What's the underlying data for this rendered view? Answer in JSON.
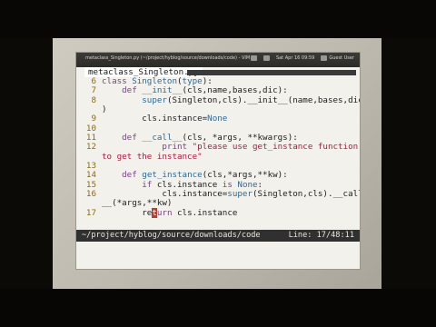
{
  "window": {
    "title": "metaclass_Singleton.py (~/project/hyblog/source/downloads/code) - VIM",
    "tray": {
      "volume": "",
      "network": "",
      "clock": "Sat Apr 16 09:59",
      "user": "Guest User"
    }
  },
  "tab": {
    "label": "metaclass_Singleton.py"
  },
  "editor": {
    "lines": [
      {
        "num": "6",
        "segments": [
          {
            "t": "class ",
            "c": "kw"
          },
          {
            "t": "Singleton",
            "c": "fn"
          },
          {
            "t": "("
          },
          {
            "t": "type",
            "c": "fn"
          },
          {
            "t": "):"
          }
        ]
      },
      {
        "num": "7",
        "segments": [
          {
            "t": "    "
          },
          {
            "t": "def ",
            "c": "kw"
          },
          {
            "t": "__init__",
            "c": "fn"
          },
          {
            "t": "(cls,name,bases,dic):"
          }
        ]
      },
      {
        "num": "8",
        "segments": [
          {
            "t": "        "
          },
          {
            "t": "super",
            "c": "fn"
          },
          {
            "t": "(Singleton,cls).__init__(name,bases,dic"
          }
        ]
      },
      {
        "num": "",
        "segments": [
          {
            "t": ")"
          }
        ]
      },
      {
        "num": "9",
        "segments": [
          {
            "t": "        cls.instance="
          },
          {
            "t": "None",
            "c": "sp"
          }
        ]
      },
      {
        "num": "10",
        "segments": [
          {
            "t": ""
          }
        ]
      },
      {
        "num": "11",
        "segments": [
          {
            "t": "    "
          },
          {
            "t": "def ",
            "c": "kw"
          },
          {
            "t": "__call__",
            "c": "fn"
          },
          {
            "t": "(cls, *args, **kwargs):"
          }
        ]
      },
      {
        "num": "12",
        "segments": [
          {
            "t": "            "
          },
          {
            "t": "print ",
            "c": "kw"
          },
          {
            "t": "\"please use get_instance function",
            "c": "str"
          }
        ]
      },
      {
        "num": "",
        "segments": [
          {
            "t": "to get the instance\"",
            "c": "str"
          }
        ]
      },
      {
        "num": "13",
        "segments": [
          {
            "t": ""
          }
        ]
      },
      {
        "num": "14",
        "segments": [
          {
            "t": "    "
          },
          {
            "t": "def ",
            "c": "kw"
          },
          {
            "t": "get_instance",
            "c": "fn"
          },
          {
            "t": "(cls,*args,**kw):"
          }
        ]
      },
      {
        "num": "15",
        "segments": [
          {
            "t": "        "
          },
          {
            "t": "if ",
            "c": "kw"
          },
          {
            "t": "cls.instance "
          },
          {
            "t": "is ",
            "c": "kw"
          },
          {
            "t": "None",
            "c": "sp"
          },
          {
            "t": ":"
          }
        ]
      },
      {
        "num": "16",
        "segments": [
          {
            "t": "            cls.instance="
          },
          {
            "t": "super",
            "c": "fn"
          },
          {
            "t": "(Singleton,cls).__call"
          }
        ]
      },
      {
        "num": "",
        "segments": [
          {
            "t": "__(*args,**kw)"
          }
        ]
      },
      {
        "num": "17",
        "segments": [
          {
            "t": "        re"
          },
          {
            "t": "t",
            "c": "cursor"
          },
          {
            "t": "urn",
            "c": "kw"
          },
          {
            "t": " cls.instance"
          }
        ]
      }
    ]
  },
  "status": {
    "path": "~/project/hyblog/source/downloads/code",
    "position": "Line: 17/48:11"
  }
}
